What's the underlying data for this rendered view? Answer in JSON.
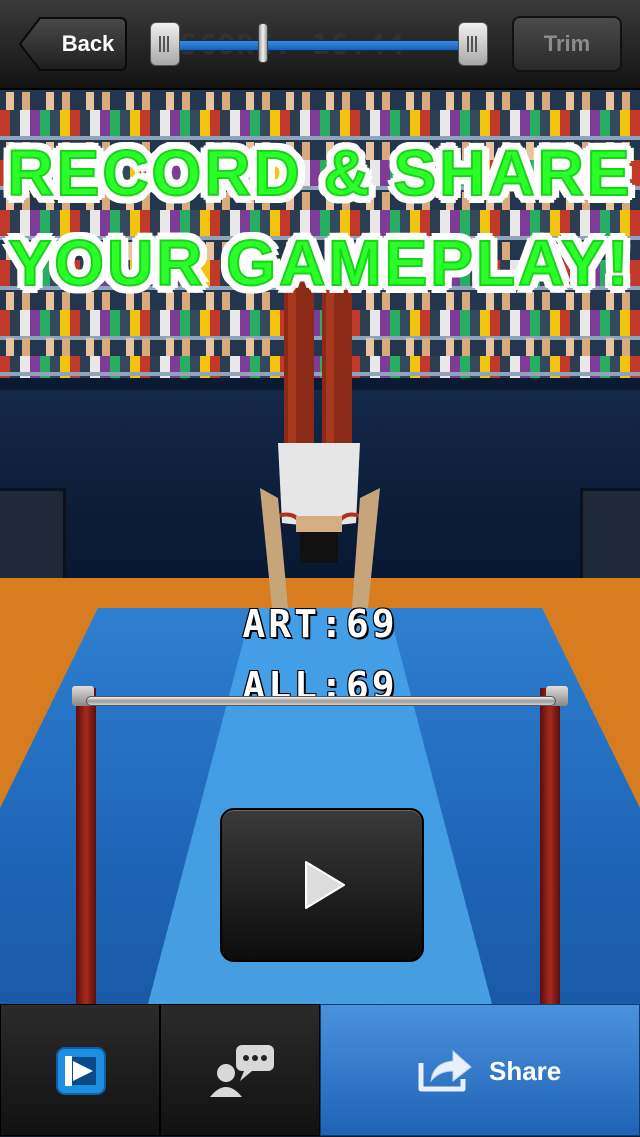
{
  "toolbar_top": {
    "back_label": "Back",
    "trim_label": "Trim",
    "ghost_text": "SCORE: 16.44"
  },
  "banner": {
    "line1": "RECORD & SHARE",
    "line2": "YOUR GAMEPLAY!",
    "color": "#2aff2a"
  },
  "scores": {
    "art": "ART:69",
    "all": "ALL:69"
  },
  "bottom_bar": {
    "share_label": "Share",
    "accent": "#2f78cc"
  },
  "icons": {
    "back": "back-arrow",
    "play": "play-triangle",
    "logo": "video-app-logo",
    "comment": "user-comment",
    "share": "share-arrow"
  }
}
